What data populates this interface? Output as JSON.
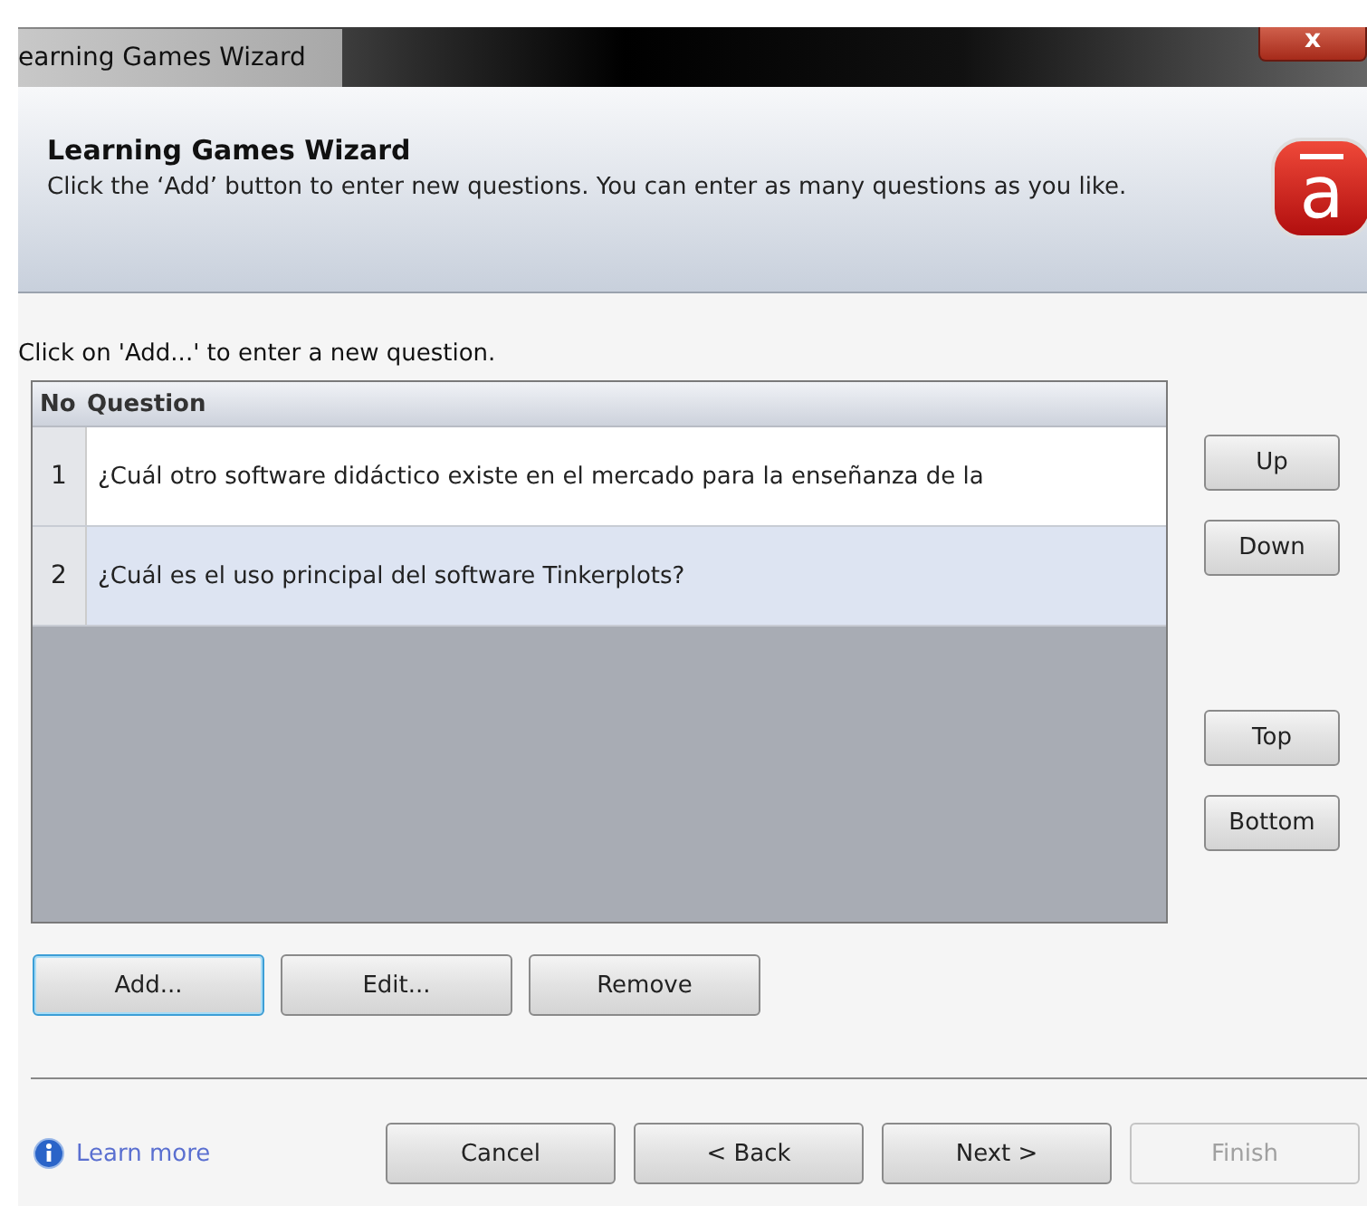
{
  "window": {
    "title": "earning Games Wizard",
    "close": "x"
  },
  "header": {
    "title": "Learning Games Wizard",
    "description": "Click the ‘Add’ button to enter new questions.  You can enter as many questions as you like.",
    "logo": "a"
  },
  "instruction": "Click on 'Add...' to enter a new question.",
  "table": {
    "columns": [
      "No",
      "Question"
    ],
    "rows": [
      {
        "no": "1",
        "question": "¿Cuál otro software didáctico existe en el mercado para la enseñanza de la",
        "selected": false
      },
      {
        "no": "2",
        "question": "¿Cuál es el uso principal del software Tinkerplots?",
        "selected": true
      }
    ]
  },
  "move_button_groups": [
    [
      "Up",
      "Down"
    ],
    [
      "Top",
      "Bottom"
    ]
  ],
  "edit_buttons": [
    {
      "label": "Add...",
      "focused": true
    },
    {
      "label": "Edit...",
      "focused": false
    },
    {
      "label": "Remove",
      "focused": false
    }
  ],
  "footer": {
    "link": "Learn more",
    "buttons": [
      {
        "label": "Cancel",
        "disabled": false
      },
      {
        "label": "< Back",
        "disabled": false
      },
      {
        "label": "Next >",
        "disabled": false
      },
      {
        "label": "Finish",
        "disabled": true
      }
    ]
  }
}
